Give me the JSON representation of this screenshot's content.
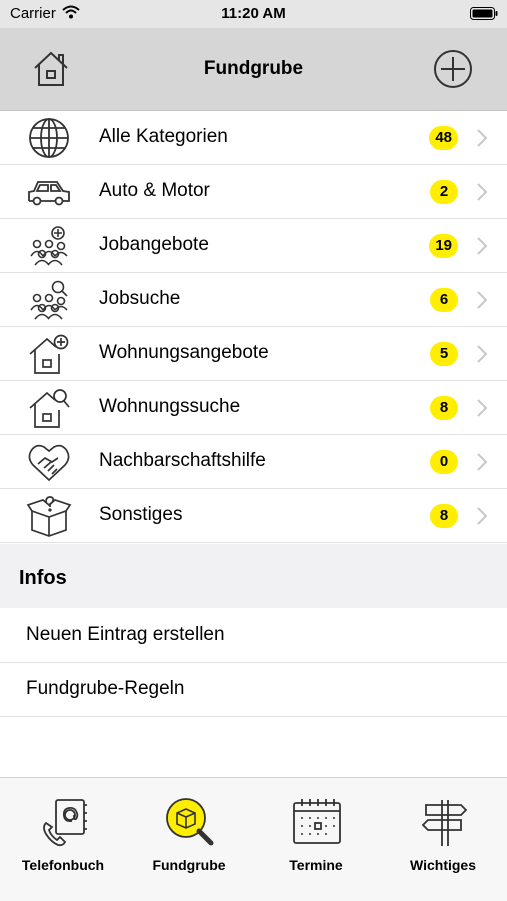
{
  "status_bar": {
    "carrier": "Carrier",
    "time": "11:20 AM"
  },
  "nav": {
    "title": "Fundgrube",
    "home_icon": "house-icon",
    "add_icon": "plus-circle-icon"
  },
  "categories": [
    {
      "label": "Alle Kategorien",
      "count": "48",
      "icon": "globe-icon"
    },
    {
      "label": "Auto & Motor",
      "count": "2",
      "icon": "car-icon"
    },
    {
      "label": "Jobangebote",
      "count": "19",
      "icon": "people-plus-icon"
    },
    {
      "label": "Jobsuche",
      "count": "6",
      "icon": "people-search-icon"
    },
    {
      "label": "Wohnungsangebote",
      "count": "5",
      "icon": "house-plus-icon"
    },
    {
      "label": "Wohnungssuche",
      "count": "8",
      "icon": "house-search-icon"
    },
    {
      "label": "Nachbarschaftshilfe",
      "count": "0",
      "icon": "heart-handshake-icon"
    },
    {
      "label": "Sonstiges",
      "count": "8",
      "icon": "box-question-icon"
    }
  ],
  "infos": {
    "header": "Infos",
    "items": [
      {
        "label": "Neuen Eintrag erstellen"
      },
      {
        "label": "Fundgrube-Regeln"
      }
    ]
  },
  "tabs": [
    {
      "label": "Telefonbuch",
      "icon": "phonebook-icon"
    },
    {
      "label": "Fundgrube",
      "icon": "box-magnifier-icon",
      "active": true
    },
    {
      "label": "Termine",
      "icon": "calendar-icon"
    },
    {
      "label": "Wichtiges",
      "icon": "signpost-icon"
    }
  ],
  "colors": {
    "accent": "#ffee00",
    "nav_bg": "#d6d6d6",
    "section_bg": "#f1f1f4"
  }
}
